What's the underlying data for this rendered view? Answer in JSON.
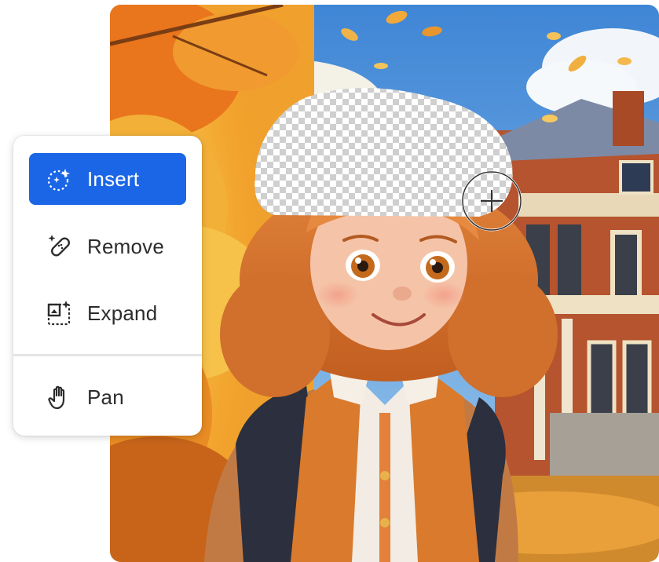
{
  "tool_menu": {
    "items": [
      {
        "label": "Insert",
        "icon": "sparkle-selection-icon",
        "selected": true
      },
      {
        "label": "Remove",
        "icon": "bandage-sparkle-icon",
        "selected": false
      },
      {
        "label": "Expand",
        "icon": "expand-sparkle-icon",
        "selected": false
      }
    ],
    "secondary_items": [
      {
        "label": "Pan",
        "icon": "hand-icon",
        "selected": false
      }
    ]
  },
  "canvas": {
    "image": "girl-with-backpack-autumn-illustration",
    "selection": "transparent-checkerboard-area",
    "cursor": "crosshair-brush-cursor-icon"
  },
  "colors": {
    "accent": "#1a66e6",
    "menu_bg": "#ffffff",
    "text": "#2c2c2c"
  }
}
